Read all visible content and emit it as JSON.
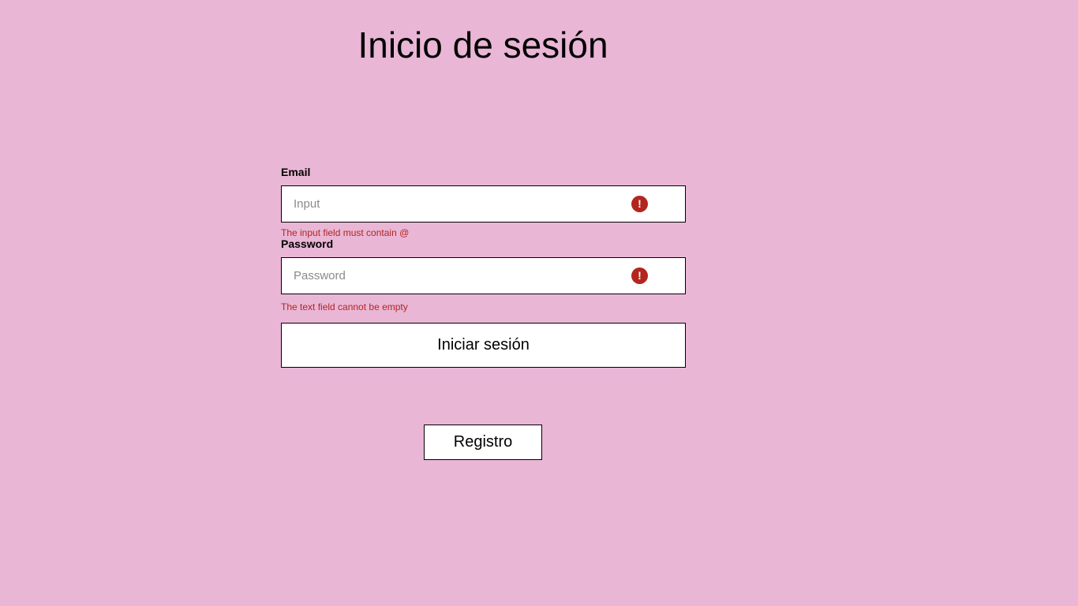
{
  "page": {
    "title": "Inicio de sesión"
  },
  "form": {
    "email": {
      "label": "Email",
      "value": "",
      "placeholder": "Input",
      "error": "The input field must contain @",
      "error_icon": "error-icon"
    },
    "password": {
      "label": "Password",
      "value": "",
      "placeholder": "Password",
      "error": "The text field cannot be empty",
      "error_icon": "error-icon"
    },
    "submit_label": "Iniciar sesión"
  },
  "register": {
    "label": "Registro"
  },
  "colors": {
    "background": "#e9b6d6",
    "error": "#b3261e",
    "surface": "#ffffff",
    "border": "#000000"
  }
}
